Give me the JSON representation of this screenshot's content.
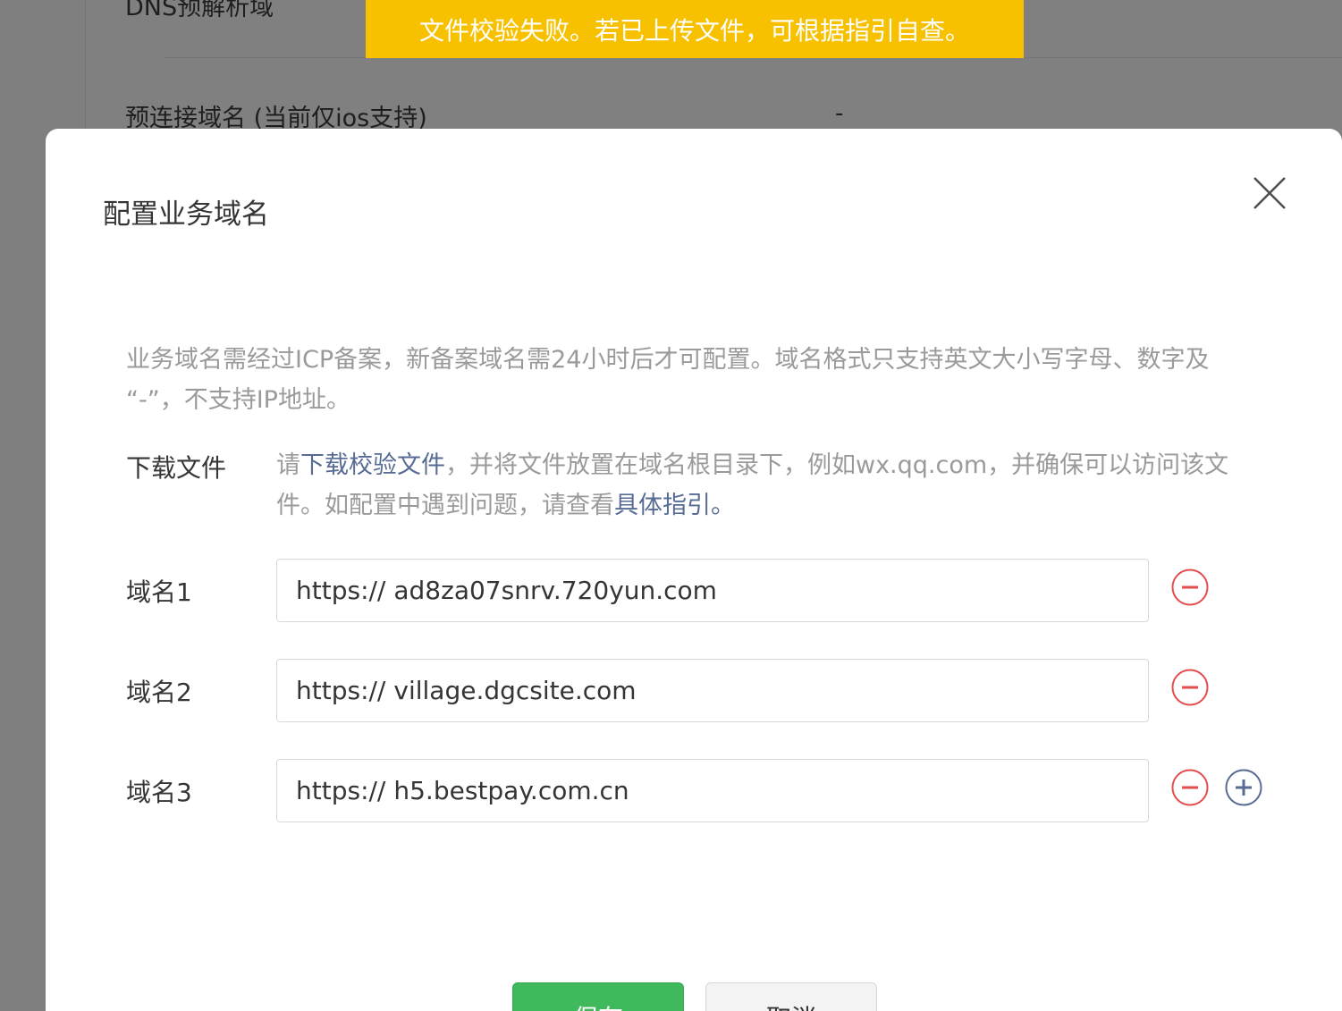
{
  "background": {
    "row_dns_label": "DNS预解析域",
    "row_preconnect_label": "预连接域名 (当前仅ios支持)",
    "row_preconnect_value": "-"
  },
  "toast": {
    "message": "文件校验失败。若已上传文件，可根据指引自查。",
    "color": "#f7c100"
  },
  "dialog": {
    "title": "配置业务域名",
    "close_icon": "close-icon",
    "notice": "业务域名需经过ICP备案，新备案域名需24小时后才可配置。域名格式只支持英文大小写字母、数字及 “-”，不支持IP地址。",
    "download": {
      "label": "下载文件",
      "text_1": "请",
      "link_1": "下载校验文件",
      "text_2": "，并将文件放置在域名根目录下，例如wx.qq.com，并确保可以访问该文件。如配置中遇到问题，请查看",
      "link_2": "具体指引。"
    },
    "domains": [
      {
        "label": "域名1",
        "prefix": "https://",
        "value": "ad8za07snrv.720yun.com"
      },
      {
        "label": "域名2",
        "prefix": "https://",
        "value": "village.dgcsite.com"
      },
      {
        "label": "域名3",
        "prefix": "https://",
        "value": "h5.bestpay.com.cn"
      }
    ],
    "remove_icon": "minus-circle-icon",
    "add_icon": "plus-circle-icon",
    "save_label": "保存",
    "cancel_label": "取消",
    "colors": {
      "remove": "#e34d4d",
      "add": "#576b95",
      "save": "#3fb95b",
      "link": "#576b95"
    }
  }
}
